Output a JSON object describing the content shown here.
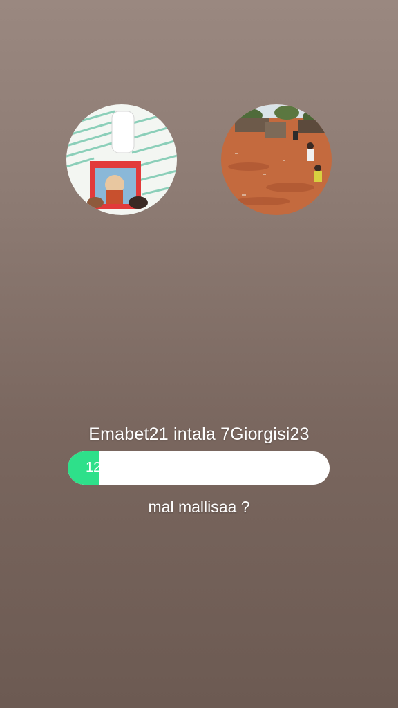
{
  "post": {
    "caption": "Emabet21 intala 7Giorgisi23",
    "progress_value": 12,
    "progress_label": "12",
    "question": "mal mallisaa ?",
    "accent_color": "#2ee08a"
  },
  "avatars": [
    {
      "name": "photo-avatar-icon-left"
    },
    {
      "name": "photo-avatar-icon-right"
    }
  ]
}
